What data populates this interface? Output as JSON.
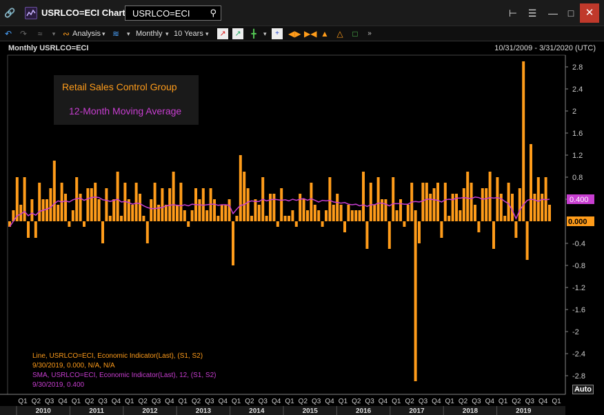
{
  "titlebar": {
    "title": "USRLCO=ECI Chart",
    "search_value": "USRLCO=ECI"
  },
  "toolbar": {
    "analysis_label": "Analysis",
    "interval_label": "Monthly",
    "range_label": "10 Years"
  },
  "chart_header": {
    "title": "Monthly USRLCO=ECI",
    "date_range": "10/31/2009 - 3/31/2020 (UTC)"
  },
  "legend": {
    "series1": "Retail Sales Control Group",
    "series2": "12-Month Moving Average"
  },
  "info": {
    "line1_label": "Line, USRLCO=ECI, Economic Indicator(Last), (S1, S2)",
    "line1_value": "9/30/2019, 0.000, N/A, N/A",
    "line2_label": "SMA, USRLCO=ECI, Economic Indicator(Last),  12, (S1, S2)",
    "line2_value": "9/30/2019, 0.400"
  },
  "auto_label": "Auto",
  "colors": {
    "bar": "#ff9c1a",
    "sma": "#c83ed1",
    "axis": "#cccccc",
    "last_bar_bg": "#ff9c1a",
    "last_sma_bg": "#c83ed1"
  },
  "chart_data": {
    "type": "bar",
    "series": [
      {
        "name": "Retail Sales Control Group",
        "type": "bar",
        "start": "2009-11",
        "values": [
          -0.1,
          0.2,
          0.8,
          0.3,
          0.8,
          -0.3,
          0.4,
          -0.3,
          0.7,
          0.4,
          0.4,
          0.6,
          1.1,
          0.3,
          0.7,
          0.5,
          -0.1,
          0.2,
          0.8,
          0.5,
          -0.1,
          0.6,
          0.6,
          0.7,
          0.4,
          -0.4,
          0.6,
          0.1,
          0.4,
          0.9,
          0.1,
          0.7,
          0.4,
          0.3,
          0.7,
          0.5,
          0.1,
          -0.4,
          0.4,
          0.7,
          0.3,
          0.6,
          0.3,
          0.6,
          0.9,
          0.3,
          0.7,
          0.2,
          -0.1,
          0.2,
          0.6,
          0.4,
          0.6,
          0.2,
          0.6,
          0.4,
          0.1,
          0.3,
          0.3,
          0.4,
          -0.8,
          0.1,
          1.2,
          0.9,
          0.6,
          0.1,
          0.4,
          0.3,
          0.8,
          0.1,
          0.5,
          0.5,
          -0.1,
          0.6,
          0.1,
          0.1,
          0.2,
          -0.1,
          0.5,
          0.4,
          0.2,
          0.7,
          0.3,
          0.2,
          -0.1,
          0.2,
          0.8,
          0.3,
          0.5,
          0.3,
          -0.2,
          0.3,
          0.2,
          0.2,
          0.2,
          0.9,
          -0.5,
          0.7,
          0.3,
          0.8,
          0.4,
          0.4,
          -0.5,
          0.8,
          0.2,
          0.4,
          -0.1,
          0.3,
          0.7,
          0.2,
          -0.4,
          0.7,
          0.7,
          0.5,
          0.6,
          0.7,
          -0.3,
          0.7,
          0.1,
          0.5,
          0.5,
          0.2,
          0.6,
          0.9,
          0.7,
          0.3,
          -0.2,
          0.6,
          0.6,
          0.9,
          -0.5,
          0.8,
          0.5,
          0.1,
          0.7,
          0.5,
          -0.3,
          0.6,
          2.9,
          -0.7,
          1.4,
          0.5,
          0.8,
          0.5,
          0.8,
          0.3
        ],
        "outliers": [
          {
            "date": "2018-12",
            "value": -2.9
          }
        ]
      },
      {
        "name": "12-Month Moving Average",
        "type": "line",
        "start": "2009-11",
        "values": [
          -0.1,
          0.0,
          0.1,
          0.13,
          0.18,
          0.1,
          0.15,
          0.11,
          0.18,
          0.2,
          0.22,
          0.25,
          0.32,
          0.37,
          0.35,
          0.37,
          0.35,
          0.39,
          0.41,
          0.42,
          0.38,
          0.41,
          0.43,
          0.44,
          0.43,
          0.39,
          0.38,
          0.36,
          0.38,
          0.4,
          0.35,
          0.36,
          0.34,
          0.31,
          0.33,
          0.32,
          0.28,
          0.25,
          0.23,
          0.23,
          0.24,
          0.25,
          0.28,
          0.29,
          0.3,
          0.29,
          0.28,
          0.3,
          0.28,
          0.31,
          0.3,
          0.3,
          0.29,
          0.3,
          0.31,
          0.31,
          0.29,
          0.3,
          0.3,
          0.29,
          0.14,
          0.22,
          0.29,
          0.3,
          0.35,
          0.37,
          0.36,
          0.36,
          0.4,
          0.37,
          0.39,
          0.4,
          0.39,
          0.38,
          0.39,
          0.37,
          0.4,
          0.38,
          0.4,
          0.41,
          0.38,
          0.41,
          0.38,
          0.35,
          0.38,
          0.37,
          0.38,
          0.35,
          0.34,
          0.33,
          0.34,
          0.31,
          0.3,
          0.31,
          0.28,
          0.3,
          0.27,
          0.3,
          0.3,
          0.33,
          0.33,
          0.31,
          0.28,
          0.32,
          0.32,
          0.32,
          0.31,
          0.31,
          0.35,
          0.36,
          0.35,
          0.37,
          0.4,
          0.4,
          0.39,
          0.38,
          0.35,
          0.39,
          0.4,
          0.39,
          0.42,
          0.42,
          0.43,
          0.42,
          0.41,
          0.44,
          0.43,
          0.4,
          0.41,
          0.43,
          0.42,
          0.43,
          0.41,
          0.36,
          0.32,
          0.2,
          0.05,
          0.2,
          0.3,
          0.38,
          0.4,
          0.39,
          0.36,
          0.4,
          0.39,
          0.4
        ],
        "last_value": 0.4
      }
    ],
    "ylim": [
      -3.1,
      3.0
    ],
    "yticks": [
      2.8,
      2.4,
      2,
      1.6,
      1.2,
      0.8,
      0.4,
      -0.4,
      -0.8,
      -1.2,
      -1.6,
      -2,
      -2.4,
      -2.8
    ],
    "ytick_labels": [
      "2.8",
      "2.4",
      "2",
      "1.6",
      "1.2",
      "0.8",
      "",
      "-0.4",
      "-0.8",
      "-1.2",
      "-1.6",
      "-2",
      "-2.4",
      "-2.8"
    ],
    "last_value_labels": {
      "bar": "0.000",
      "sma": "0.400"
    },
    "xlabel_quarters": [
      "Q1",
      "Q2",
      "Q3",
      "Q4",
      "Q1",
      "Q2",
      "Q3",
      "Q4",
      "Q1",
      "Q2",
      "Q3",
      "Q4",
      "Q1",
      "Q2",
      "Q3",
      "Q4",
      "Q1",
      "Q2",
      "Q3",
      "Q4",
      "Q1",
      "Q2",
      "Q3",
      "Q4",
      "Q1",
      "Q2",
      "Q3",
      "Q4",
      "Q1",
      "Q2",
      "Q3",
      "Q4",
      "Q1",
      "Q2",
      "Q3",
      "Q4",
      "Q1",
      "Q2",
      "Q3",
      "Q4",
      "Q1"
    ],
    "xlabel_years": [
      "2010",
      "2011",
      "2012",
      "2013",
      "2014",
      "2015",
      "2016",
      "2017",
      "2018",
      "2019"
    ],
    "grid": false,
    "legend_position": "top-left"
  }
}
